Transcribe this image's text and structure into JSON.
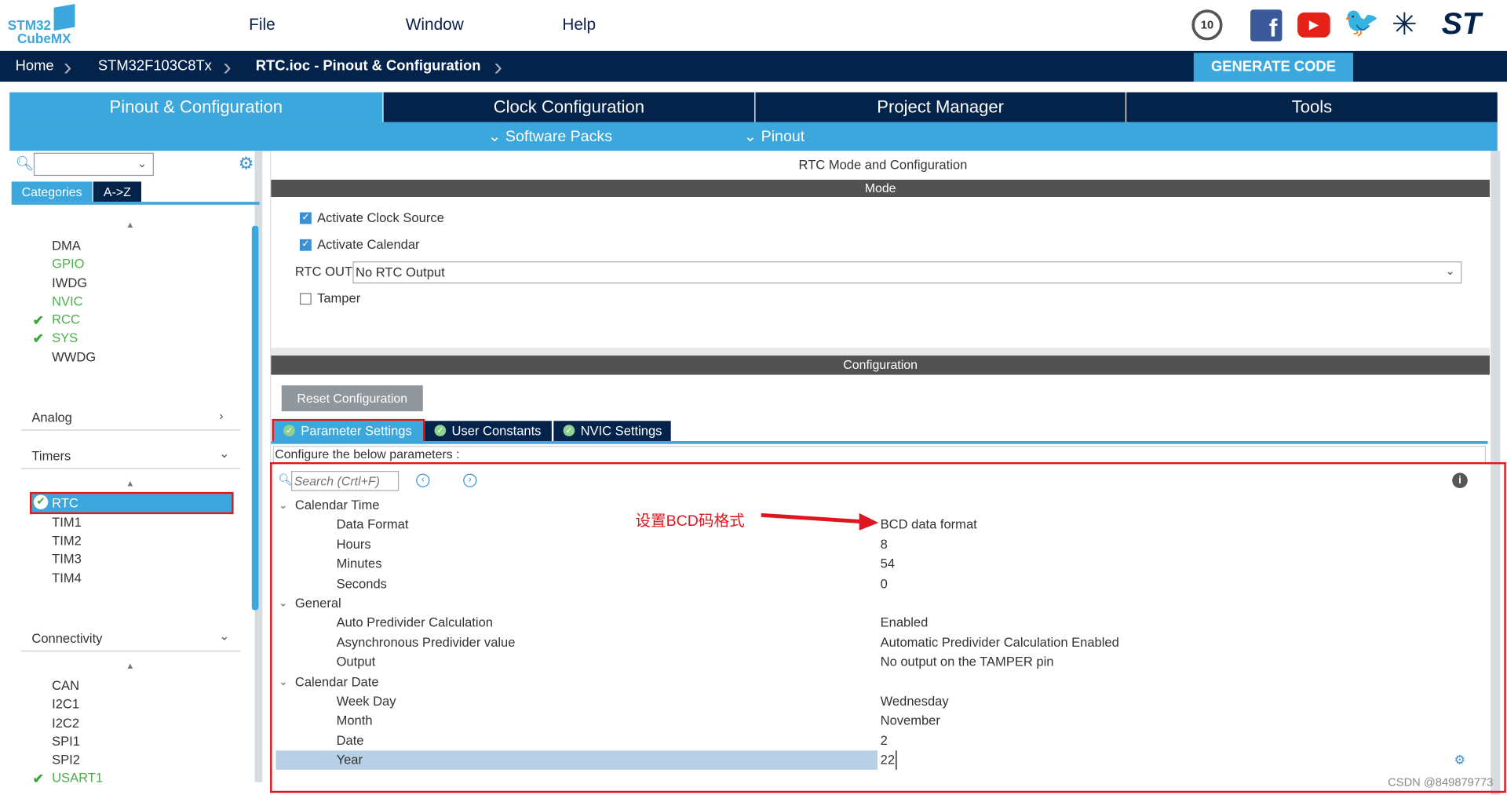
{
  "app": {
    "logo_line1": "STM32",
    "logo_line2": "CubeMX",
    "brand_color": "#03234b",
    "accent": "#3ca7dc"
  },
  "menu": [
    "File",
    "Window",
    "Help"
  ],
  "social_icons": [
    "anniversary-badge-icon",
    "facebook-icon",
    "youtube-icon",
    "twitter-icon",
    "network-icon",
    "st-logo-icon"
  ],
  "breadcrumb": [
    "Home",
    "STM32F103C8Tx",
    "RTC.ioc - Pinout & Configuration"
  ],
  "generate_label": "GENERATE CODE",
  "main_tabs": [
    "Pinout & Configuration",
    "Clock Configuration",
    "Project Manager",
    "Tools"
  ],
  "sub_menus": [
    "Software Packs",
    "Pinout"
  ],
  "sidebar": {
    "tabs": [
      "Categories",
      "A->Z"
    ],
    "system_items": [
      {
        "label": "DMA",
        "state": ""
      },
      {
        "label": "GPIO",
        "state": "green"
      },
      {
        "label": "IWDG",
        "state": ""
      },
      {
        "label": "NVIC",
        "state": "green"
      },
      {
        "label": "RCC",
        "state": "checked"
      },
      {
        "label": "SYS",
        "state": "checked"
      },
      {
        "label": "WWDG",
        "state": ""
      }
    ],
    "categories": [
      "Analog",
      "Timers",
      "Connectivity"
    ],
    "timer_items": [
      "RTC",
      "TIM1",
      "TIM2",
      "TIM3",
      "TIM4"
    ],
    "connectivity_items": [
      "CAN",
      "I2C1",
      "I2C2",
      "SPI1",
      "SPI2",
      "USART1"
    ]
  },
  "panel": {
    "title": "RTC Mode and Configuration",
    "mode_header": "Mode",
    "activate_clock_source": "Activate Clock Source",
    "activate_calendar": "Activate Calendar",
    "rtc_out_label": "RTC OUT",
    "rtc_out_value": "No RTC Output",
    "tamper": "Tamper",
    "config_header": "Configuration",
    "reset_label": "Reset Configuration",
    "param_tabs": [
      "Parameter Settings",
      "User Constants",
      "NVIC Settings"
    ],
    "configure_text": "Configure the below parameters :",
    "search_placeholder": "Search (Crtl+F)",
    "groups": [
      {
        "name": "Calendar Time",
        "params": [
          [
            "Data Format",
            "BCD data format"
          ],
          [
            "Hours",
            "8"
          ],
          [
            "Minutes",
            "54"
          ],
          [
            "Seconds",
            "0"
          ]
        ]
      },
      {
        "name": "General",
        "params": [
          [
            "Auto Predivider Calculation",
            "Enabled"
          ],
          [
            "Asynchronous Predivider value",
            "Automatic Predivider Calculation Enabled"
          ],
          [
            "Output",
            "No output on the TAMPER pin"
          ]
        ]
      },
      {
        "name": "Calendar Date",
        "params": [
          [
            "Week Day",
            "Wednesday"
          ],
          [
            "Month",
            "November"
          ],
          [
            "Date",
            "2"
          ],
          [
            "Year",
            "22"
          ]
        ]
      }
    ]
  },
  "annotation": "设置BCD码格式",
  "watermark": "CSDN @849879773"
}
